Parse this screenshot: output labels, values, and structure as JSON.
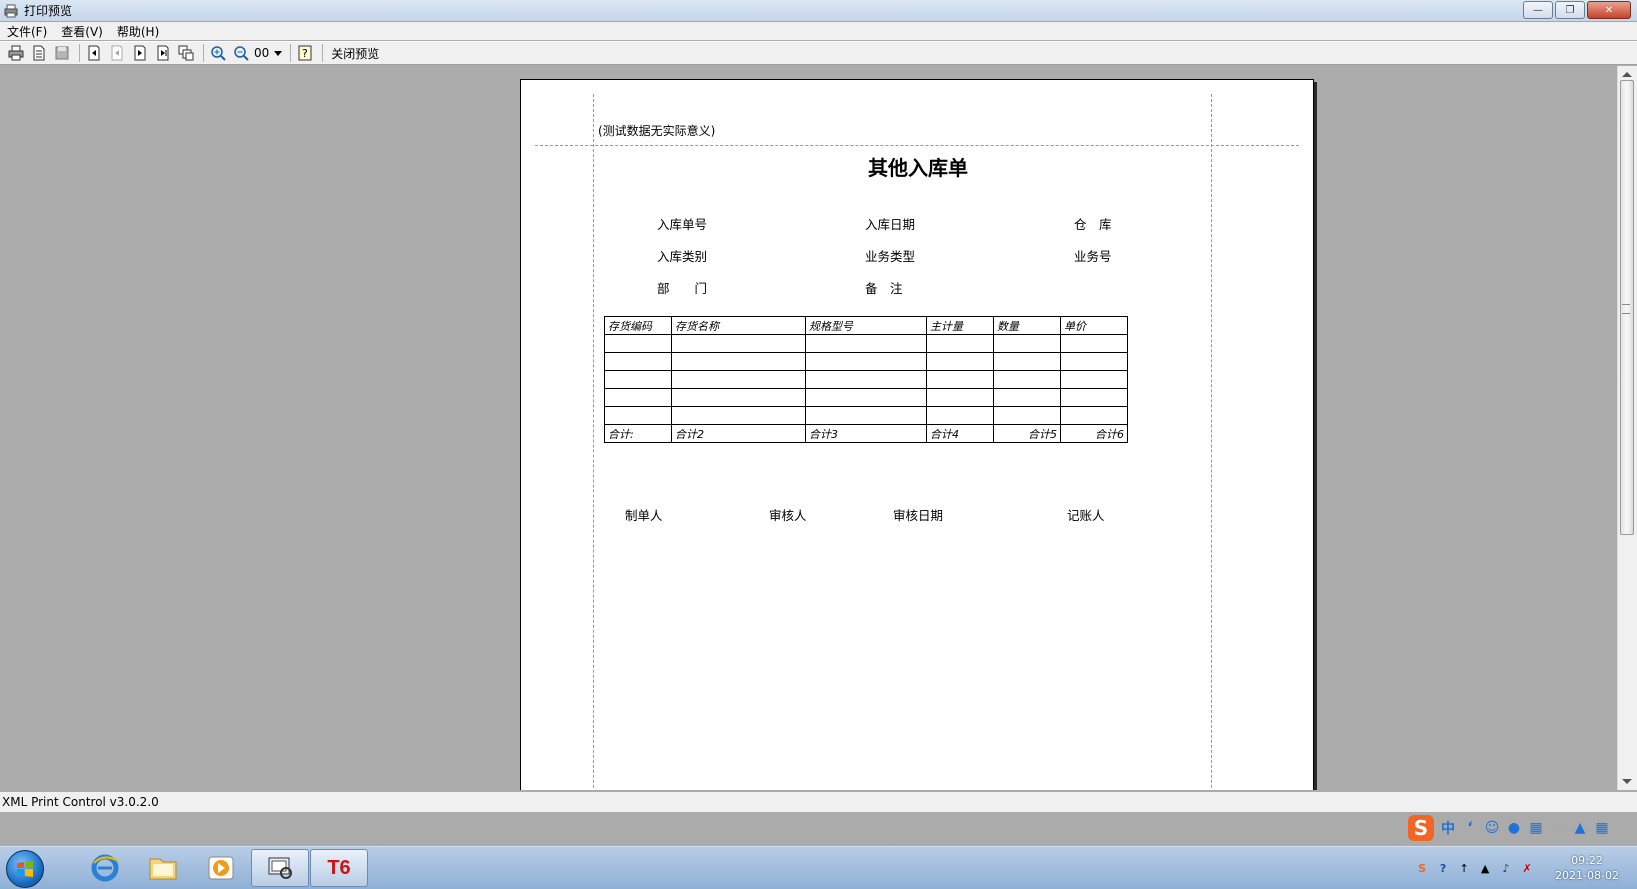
{
  "window": {
    "title": "打印预览"
  },
  "menu": [
    {
      "label": "文件(F)"
    },
    {
      "label": "查看(V)"
    },
    {
      "label": "帮助(H)"
    }
  ],
  "toolbar": {
    "zoom_value": "00",
    "close_preview_label": "关闭预览",
    "icons": [
      "print-icon",
      "page-setup-icon",
      "save-icon",
      "first-page-icon",
      "prev-page-icon",
      "next-page-icon",
      "last-page-icon",
      "multi-page-icon",
      "zoom-in-icon",
      "zoom-out-icon",
      "help-icon"
    ]
  },
  "document": {
    "note": "(测试数据无实际意义)",
    "title": "其他入库单",
    "fields": {
      "order_no": "入库单号",
      "in_date": "入库日期",
      "warehouse": "仓　库",
      "in_category": "入库类别",
      "business_type": "业务类型",
      "business_no": "业务号",
      "department": "部　　门",
      "remark": "备　注"
    },
    "table": {
      "headers": [
        "存货编码",
        "存货名称",
        "规格型号",
        "主计量",
        "数量",
        "单价"
      ],
      "empty_rows": 5,
      "totals": [
        "合计:",
        "合计2",
        "合计3",
        "合计4",
        "合计5",
        "合计6"
      ]
    },
    "signatures": {
      "maker": "制单人",
      "reviewer": "审核人",
      "review_date": "审核日期",
      "bookkeeper": "记账人"
    }
  },
  "status": {
    "text": "XML Print Control v3.0.2.0"
  },
  "ime": {
    "logo": "S",
    "mode": "中"
  },
  "taskbar": {
    "t6_label": "T6",
    "clock_time": "09:22",
    "clock_date": "2021-08-02"
  }
}
